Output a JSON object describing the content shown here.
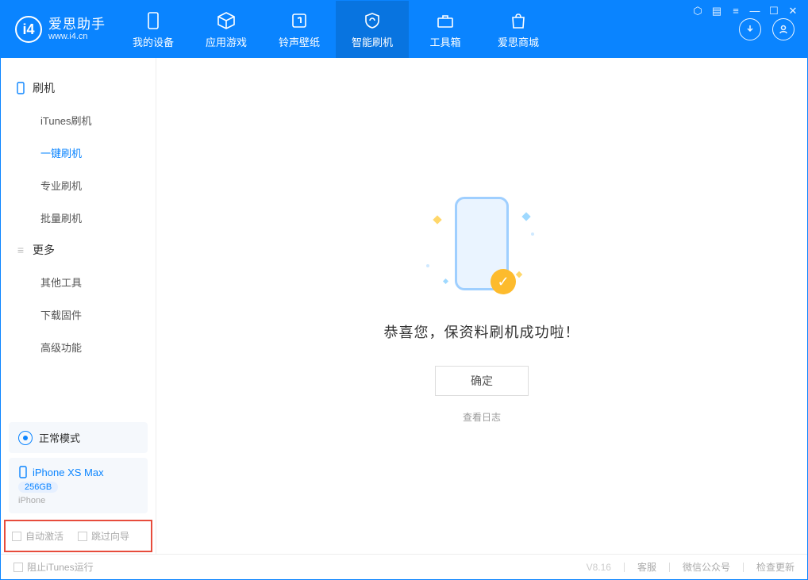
{
  "app": {
    "name_cn": "爱思助手",
    "name_en": "www.i4.cn"
  },
  "nav": {
    "items": [
      {
        "label": "我的设备"
      },
      {
        "label": "应用游戏"
      },
      {
        "label": "铃声壁纸"
      },
      {
        "label": "智能刷机"
      },
      {
        "label": "工具箱"
      },
      {
        "label": "爱思商城"
      }
    ],
    "active_index": 3
  },
  "sidebar": {
    "group1": {
      "title": "刷机",
      "items": [
        "iTunes刷机",
        "一键刷机",
        "专业刷机",
        "批量刷机"
      ],
      "active_index": 1
    },
    "group2": {
      "title": "更多",
      "items": [
        "其他工具",
        "下载固件",
        "高级功能"
      ]
    },
    "mode_card": {
      "label": "正常模式"
    },
    "device_card": {
      "name": "iPhone XS Max",
      "capacity": "256GB",
      "model": "iPhone"
    },
    "checks": {
      "auto_activate": "自动激活",
      "skip_guide": "跳过向导"
    }
  },
  "main": {
    "success_text": "恭喜您，保资料刷机成功啦！",
    "ok_button": "确定",
    "view_log": "查看日志"
  },
  "footer": {
    "block_itunes": "阻止iTunes运行",
    "version": "V8.16",
    "links": [
      "客服",
      "微信公众号",
      "检查更新"
    ]
  }
}
